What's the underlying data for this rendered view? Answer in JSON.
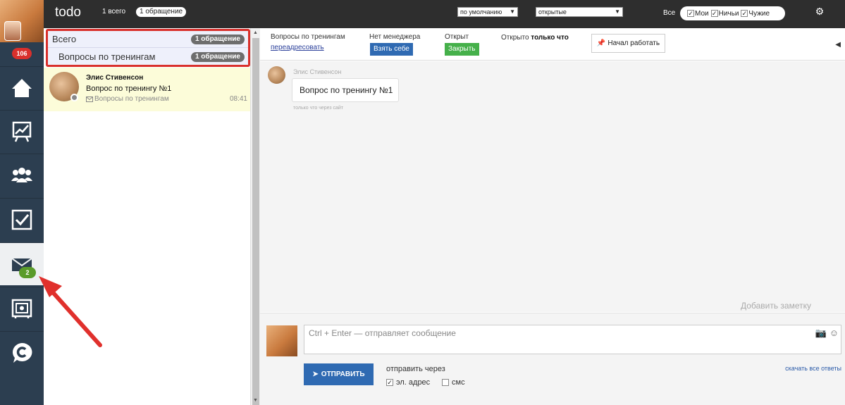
{
  "app": {
    "title": "todo"
  },
  "topbar": {
    "total_label": "1 всего",
    "requests_pill": "1 обращение",
    "sort_select": "по умолчанию",
    "status_select": "открытые",
    "all_label": "Все",
    "filters": [
      {
        "label": "Мои",
        "checked": true
      },
      {
        "label": "Ничьи",
        "checked": true
      },
      {
        "label": "Чужие",
        "checked": true
      }
    ]
  },
  "sidebar": {
    "notification_count": "106",
    "mail_badge": "2",
    "items": [
      "home",
      "analytics",
      "users",
      "tasks",
      "mail",
      "safe",
      "chat"
    ]
  },
  "groups": [
    {
      "label": "Всего",
      "count": "1 обращение"
    },
    {
      "label": "Вопросы по тренингам",
      "count": "1 обращение"
    }
  ],
  "conversation": {
    "name": "Элис Стивенсон",
    "message": "Вопрос по тренингу №1",
    "group": "Вопросы по тренингам",
    "time": "08:41"
  },
  "infobar": {
    "group_label": "Вопросы по тренингам",
    "reassign_link": "переадресовать",
    "manager_label": "Нет менеджера",
    "take_button": "Взять себе",
    "status_label": "Открыт",
    "close_button": "Закрыть",
    "opened_prefix": "Открыто",
    "opened_value": "только что",
    "start_button": "Начал работать"
  },
  "chat": {
    "author": "Элис Стивенсон",
    "text": "Вопрос по тренингу №1",
    "via": "только что через сайт"
  },
  "composer": {
    "add_note": "Добавить заметку",
    "placeholder": "Ctrl + Enter — отправляет сообщение",
    "send_button": "ОТПРАВИТЬ",
    "send_via_label": "отправить через",
    "channels": [
      {
        "label": "эл. адрес",
        "checked": true
      },
      {
        "label": "смс",
        "checked": false
      }
    ],
    "download_link": "скачать все ответы"
  },
  "colors": {
    "sidebar": "#2c3e50",
    "topbar": "#2e2e2e",
    "accent_blue": "#2f6ab2",
    "accent_green": "#45b04a",
    "highlight_red": "#d9302c"
  }
}
